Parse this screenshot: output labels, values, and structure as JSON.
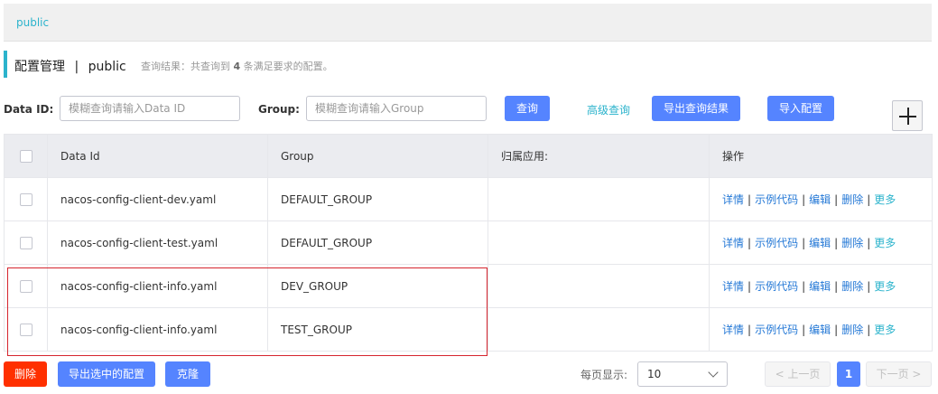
{
  "namespace": {
    "current": "public"
  },
  "header": {
    "title": "配置管理",
    "separator": "|",
    "namespace": "public",
    "hint_prefix": "查询结果：共查询到",
    "hint_count": "4",
    "hint_suffix": "条满足要求的配置。"
  },
  "search": {
    "data_id_label": "Data ID:",
    "data_id_placeholder": "模糊查询请输入Data ID",
    "group_label": "Group:",
    "group_placeholder": "模糊查询请输入Group",
    "query_button": "查询",
    "advanced_link": "高级查询",
    "export_button": "导出查询结果",
    "import_button": "导入配置"
  },
  "table": {
    "columns": [
      "Data Id",
      "Group",
      "归属应用:",
      "操作"
    ],
    "rows": [
      {
        "data_id": "nacos-config-client-dev.yaml",
        "group": "DEFAULT_GROUP",
        "app": ""
      },
      {
        "data_id": "nacos-config-client-test.yaml",
        "group": "DEFAULT_GROUP",
        "app": ""
      },
      {
        "data_id": "nacos-config-client-info.yaml",
        "group": "DEV_GROUP",
        "app": ""
      },
      {
        "data_id": "nacos-config-client-info.yaml",
        "group": "TEST_GROUP",
        "app": ""
      }
    ],
    "actions": {
      "detail": "详情",
      "sample_code": "示例代码",
      "edit": "编辑",
      "delete": "删除",
      "more": "更多",
      "sep": "|"
    }
  },
  "footer": {
    "delete_button": "删除",
    "export_selected_button": "导出选中的配置",
    "clone_button": "克隆",
    "page_size_label": "每页显示:",
    "page_size_value": "10",
    "prev_label": "< 上一页",
    "current_page": "1",
    "next_label": "下一页 >"
  },
  "colors": {
    "accent": "#2bb3cc",
    "primary": "#5584ff",
    "danger": "#ff3000",
    "highlight_box": "#d5252e"
  }
}
